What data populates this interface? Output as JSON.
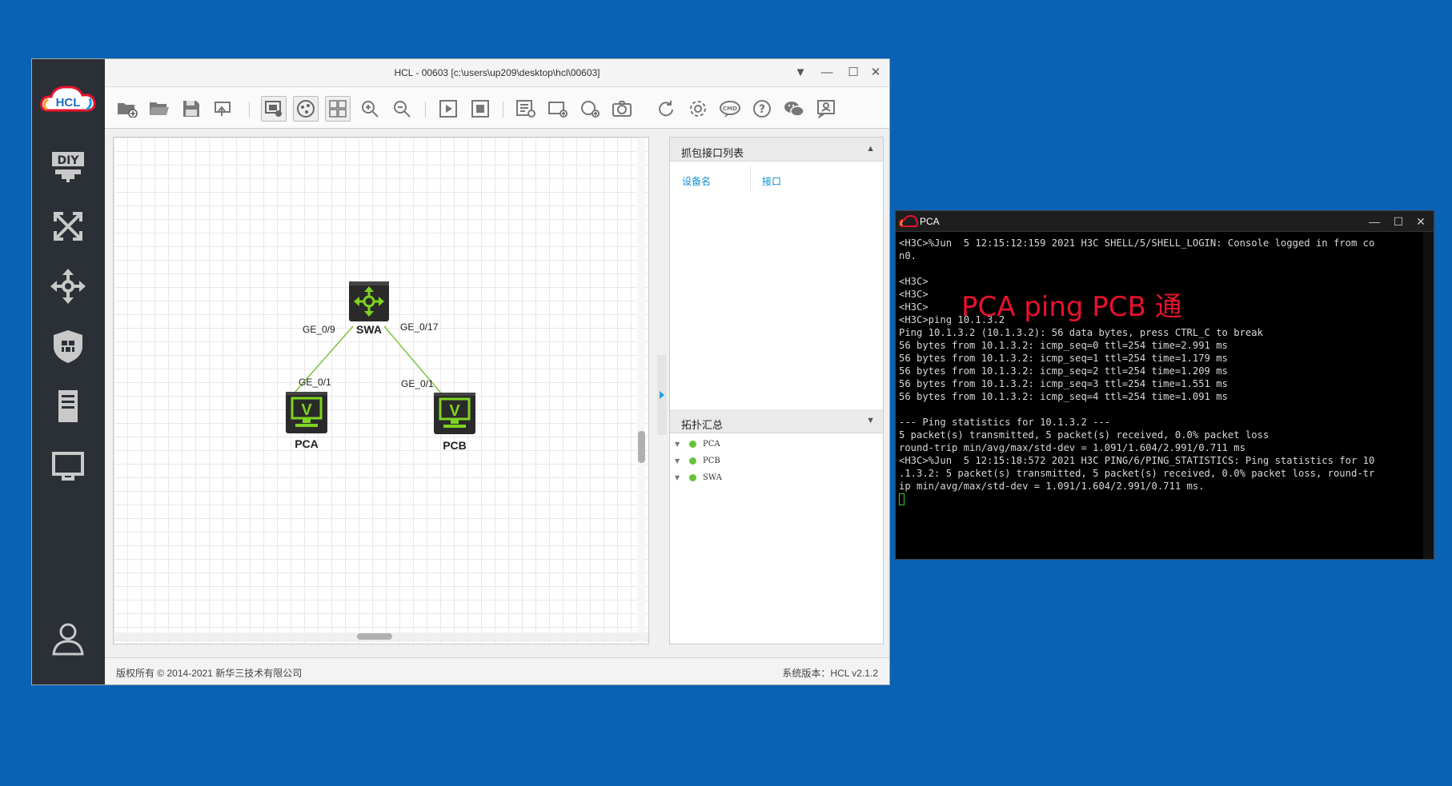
{
  "hcl_window": {
    "title": "HCL - 00603 [c:\\users\\up209\\desktop\\hcl\\00603]",
    "logo_text": "HCL",
    "sidebar_diy": "DIY"
  },
  "topology": {
    "devices": {
      "swa": "SWA",
      "pca": "PCA",
      "pcb": "PCB"
    },
    "links": {
      "swa_left_port": "GE_0/9",
      "swa_right_port": "GE_0/17",
      "pca_port": "GE_0/1",
      "pcb_port": "GE_0/1"
    }
  },
  "capture_panel": {
    "title": "抓包接口列表",
    "columns": [
      "设备名",
      "接口"
    ]
  },
  "topo_summary": {
    "title": "拓扑汇总",
    "items": [
      "PCA",
      "PCB",
      "SWA"
    ]
  },
  "statusbar": {
    "copyright": "版权所有 © 2014-2021 新华三技术有限公司",
    "version": "系统版本：HCL v2.1.2"
  },
  "terminal": {
    "title": "PCA",
    "lines": [
      "<H3C>%Jun  5 12:15:12:159 2021 H3C SHELL/5/SHELL_LOGIN: Console logged in from co",
      "n0.",
      "",
      "<H3C>",
      "<H3C>",
      "<H3C>",
      "<H3C>ping 10.1.3.2",
      "Ping 10.1.3.2 (10.1.3.2): 56 data bytes, press CTRL_C to break",
      "56 bytes from 10.1.3.2: icmp_seq=0 ttl=254 time=2.991 ms",
      "56 bytes from 10.1.3.2: icmp_seq=1 ttl=254 time=1.179 ms",
      "56 bytes from 10.1.3.2: icmp_seq=2 ttl=254 time=1.209 ms",
      "56 bytes from 10.1.3.2: icmp_seq=3 ttl=254 time=1.551 ms",
      "56 bytes from 10.1.3.2: icmp_seq=4 ttl=254 time=1.091 ms",
      "",
      "--- Ping statistics for 10.1.3.2 ---",
      "5 packet(s) transmitted, 5 packet(s) received, 0.0% packet loss",
      "round-trip min/avg/max/std-dev = 1.091/1.604/2.991/0.711 ms",
      "<H3C>%Jun  5 12:15:18:572 2021 H3C PING/6/PING_STATISTICS: Ping statistics for 10",
      ".1.3.2: 5 packet(s) transmitted, 5 packet(s) received, 0.0% packet loss, round-tr",
      "ip min/avg/max/std-dev = 1.091/1.604/2.991/0.711 ms."
    ]
  },
  "annotation": "PCA ping PCB 通",
  "colors": {
    "desktop": "#0b61b4",
    "sidebar": "#2b2f36",
    "link": "#7cc43f",
    "annotation": "#e8112d",
    "accent": "#0f8fd8"
  }
}
